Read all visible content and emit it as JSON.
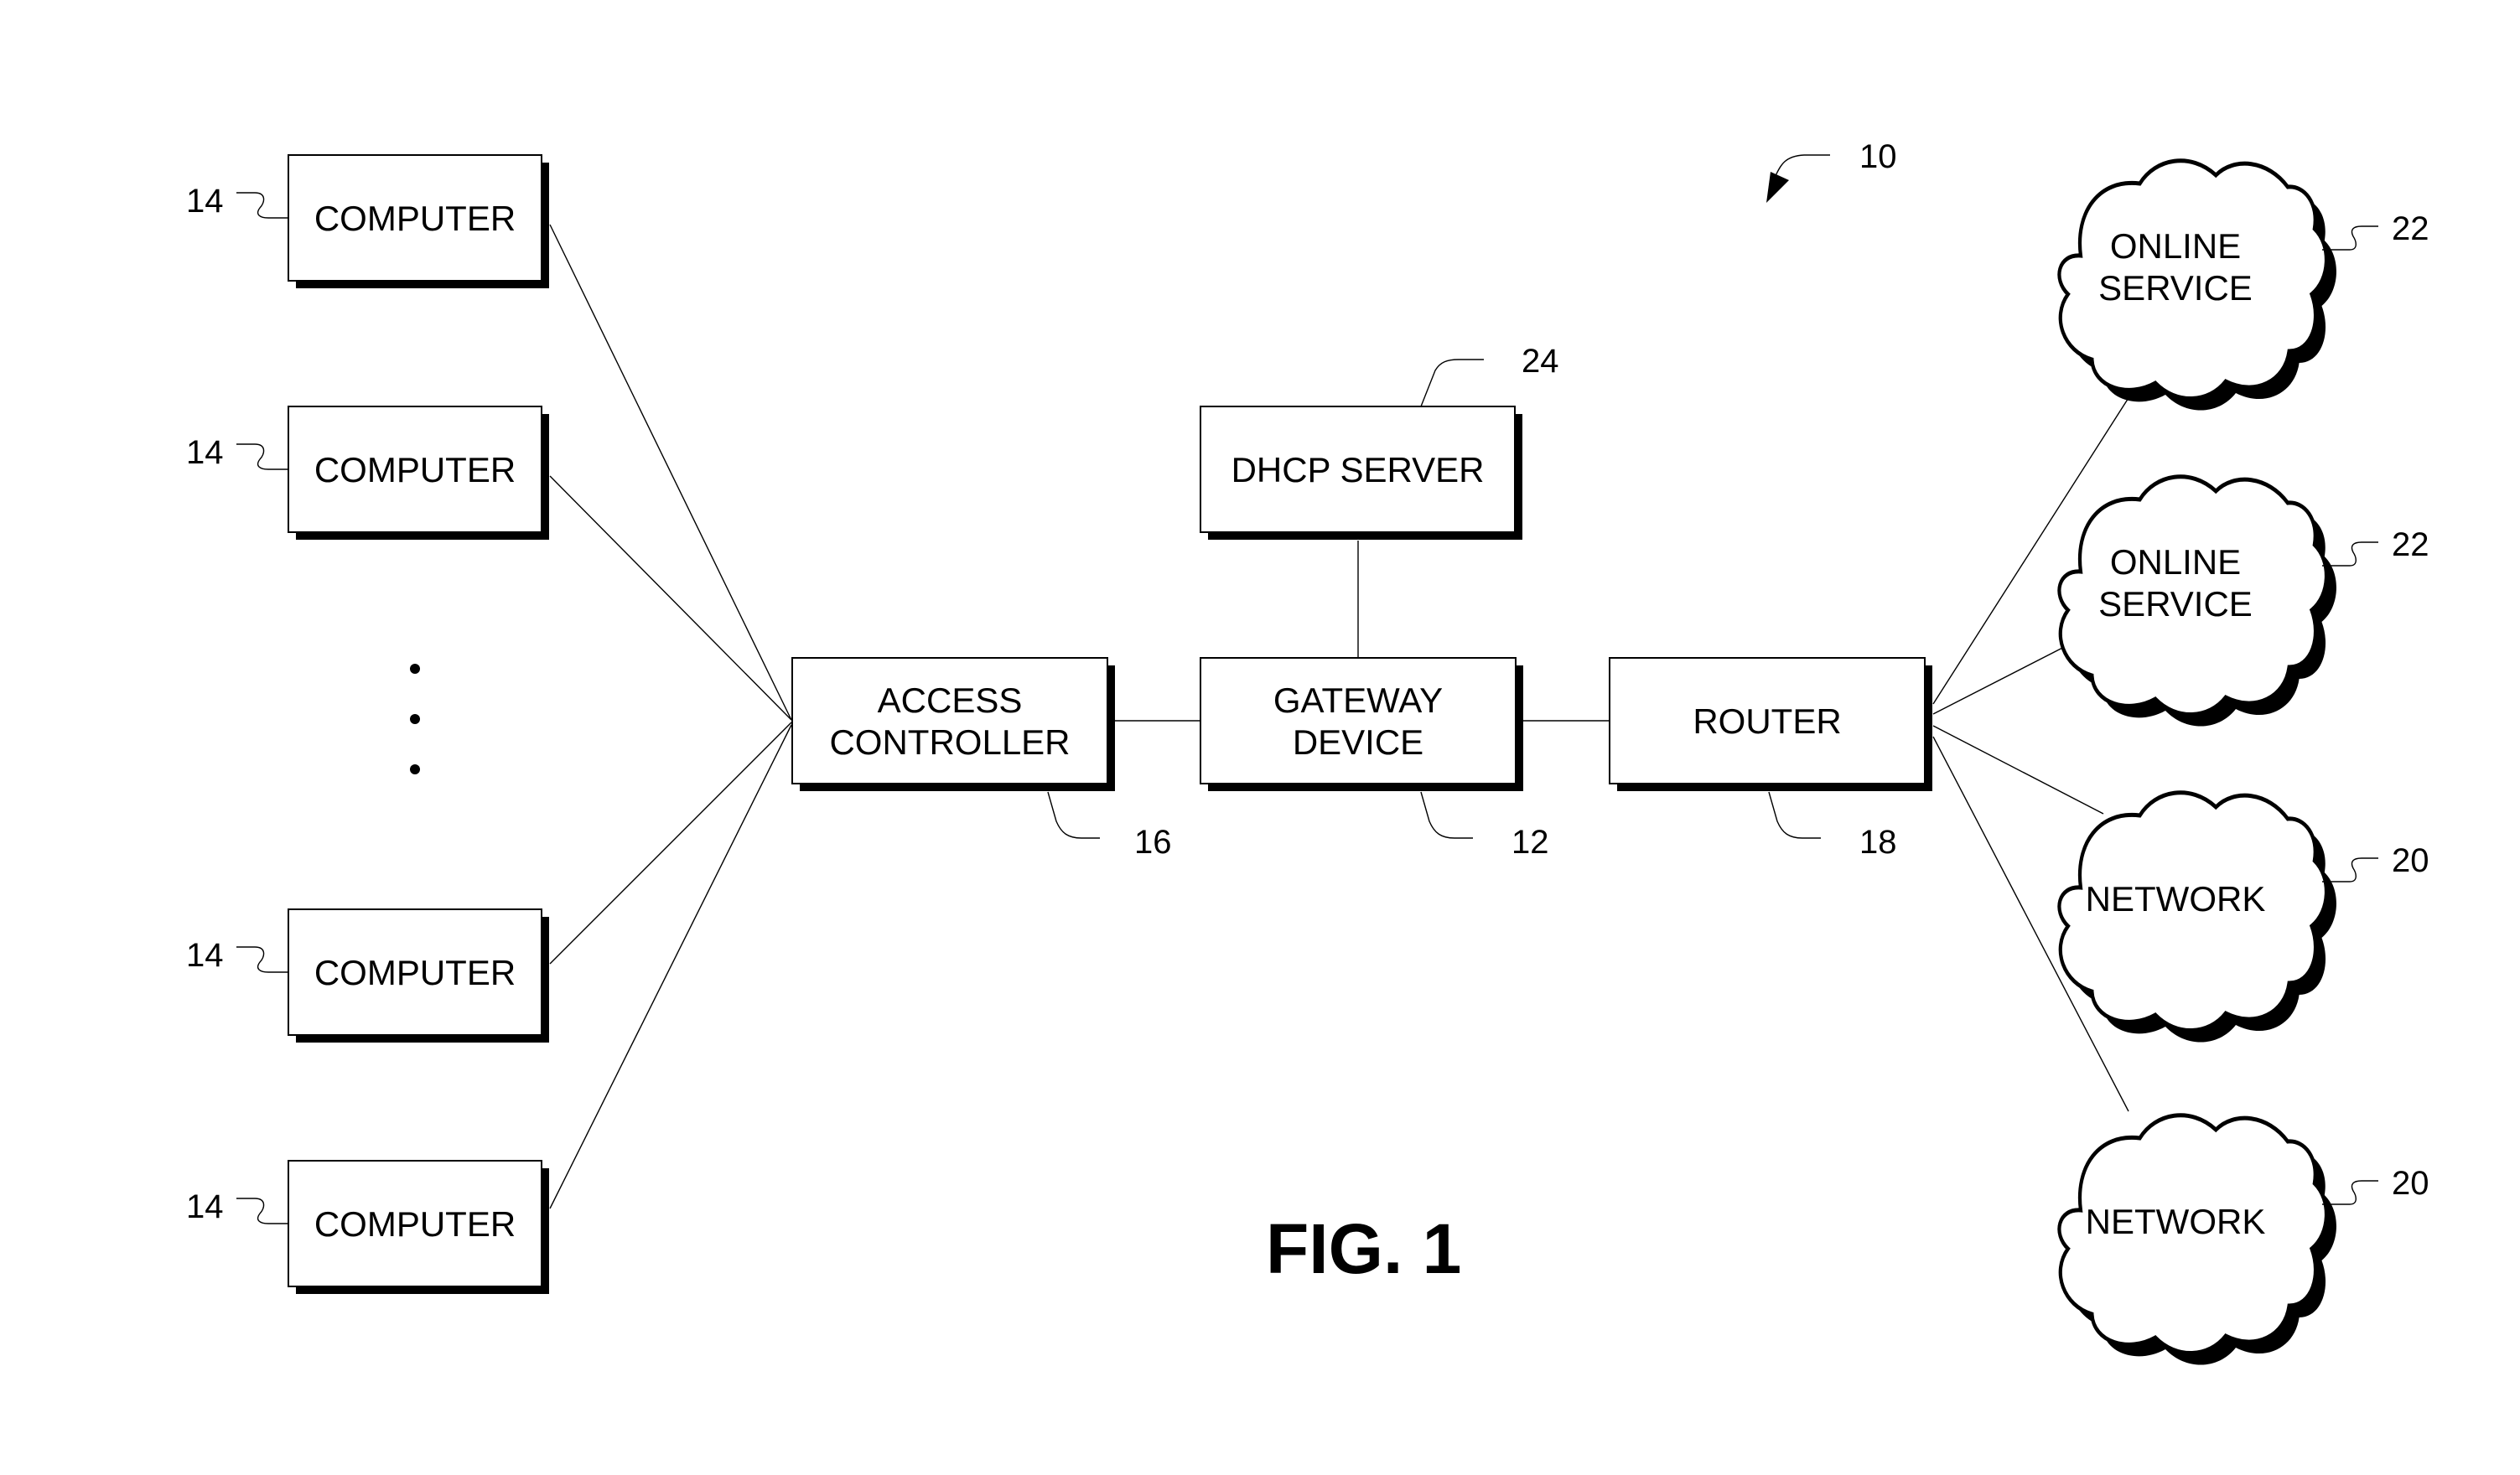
{
  "figure": {
    "title": "FIG. 1",
    "system_reference": "10"
  },
  "computers": [
    {
      "label": "COMPUTER",
      "reference": "14"
    },
    {
      "label": "COMPUTER",
      "reference": "14"
    },
    {
      "label": "COMPUTER",
      "reference": "14"
    },
    {
      "label": "COMPUTER",
      "reference": "14"
    }
  ],
  "ellipsis": "...",
  "access_controller": {
    "lines": [
      "ACCESS",
      "CONTROLLER"
    ],
    "reference": "16"
  },
  "gateway_device": {
    "lines": [
      "GATEWAY",
      "DEVICE"
    ],
    "reference": "12"
  },
  "dhcp_server": {
    "lines": [
      "DHCP SERVER"
    ],
    "reference": "24"
  },
  "router": {
    "lines": [
      "ROUTER"
    ],
    "reference": "18"
  },
  "clouds": [
    {
      "lines": [
        "ONLINE",
        "SERVICE"
      ],
      "reference": "22"
    },
    {
      "lines": [
        "ONLINE",
        "SERVICE"
      ],
      "reference": "22"
    },
    {
      "lines": [
        "NETWORK"
      ],
      "reference": "20"
    },
    {
      "lines": [
        "NETWORK"
      ],
      "reference": "20"
    }
  ],
  "connections": [
    [
      "computer-0",
      "access-controller"
    ],
    [
      "computer-1",
      "access-controller"
    ],
    [
      "computer-2",
      "access-controller"
    ],
    [
      "computer-3",
      "access-controller"
    ],
    [
      "access-controller",
      "gateway-device"
    ],
    [
      "dhcp-server",
      "gateway-device"
    ],
    [
      "gateway-device",
      "router"
    ],
    [
      "router",
      "cloud-0"
    ],
    [
      "router",
      "cloud-1"
    ],
    [
      "router",
      "cloud-2"
    ],
    [
      "router",
      "cloud-3"
    ]
  ]
}
